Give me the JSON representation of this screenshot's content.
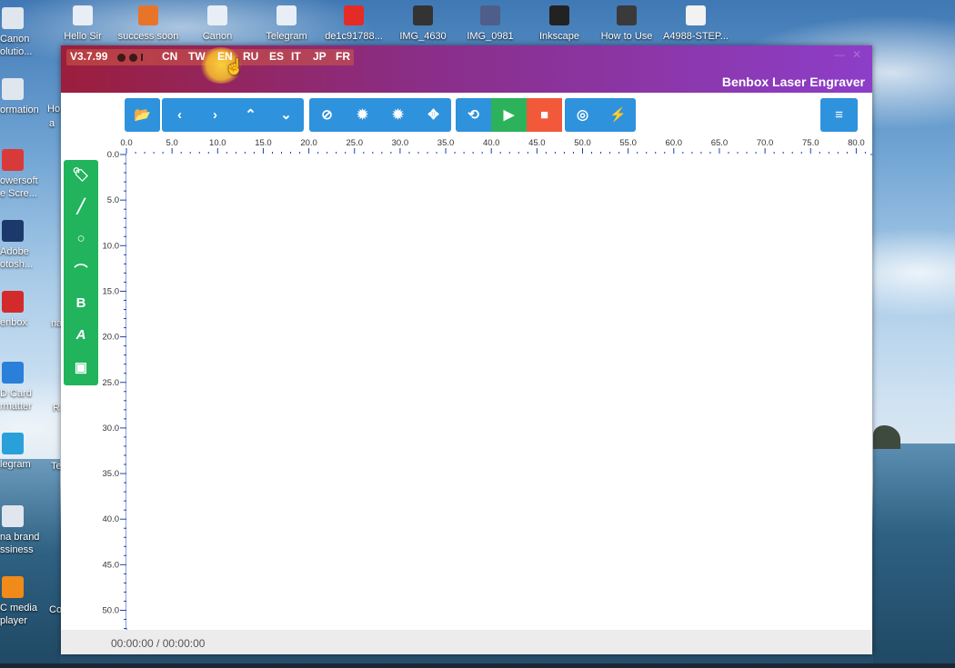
{
  "desktop": {
    "top_icons": [
      {
        "label": "Hello Sir",
        "icon": "document-icon",
        "color": "#e8eef5"
      },
      {
        "label": "success soon",
        "icon": "archive-icon",
        "color": "#e8742a"
      },
      {
        "label": "Canon",
        "icon": "document-icon",
        "color": "#e8eef5"
      },
      {
        "label": "Telegram",
        "icon": "document-icon",
        "color": "#e8eef5"
      },
      {
        "label": "de1c91788...",
        "icon": "youtube-icon",
        "color": "#e52b26"
      },
      {
        "label": "IMG_4630",
        "icon": "image-icon",
        "color": "#333333"
      },
      {
        "label": "IMG_0981",
        "icon": "image-icon",
        "color": "#4e5d8a"
      },
      {
        "label": "Inkscape",
        "icon": "inkscape-icon",
        "color": "#222222"
      },
      {
        "label": "How to Use",
        "icon": "image-icon",
        "color": "#3a3a3a"
      },
      {
        "label": "A4988-STEP...",
        "icon": "document-icon",
        "color": "#f2f2f2"
      }
    ],
    "left_icons": [
      {
        "label": "Canon",
        "label2": "olutio...",
        "icon": "document-icon",
        "color": "#dfe6ee"
      },
      {
        "label": "ormation",
        "label2": "",
        "icon": "document-icon",
        "color": "#dfe6ee"
      },
      {
        "label": "owersoft",
        "label2": "e Scre...",
        "icon": "record-icon",
        "color": "#d83a3a"
      },
      {
        "label": "Adobe",
        "label2": "otosh...",
        "icon": "photoshop-icon",
        "color": "#1b3a6b"
      },
      {
        "label": "enbox",
        "label2": "",
        "icon": "benbox-icon",
        "color": "#d32b2b"
      },
      {
        "label": "D Card",
        "label2": "rmatter",
        "icon": "sdcard-icon",
        "color": "#2a7fd8"
      },
      {
        "label": "legram",
        "label2": "",
        "icon": "telegram-icon",
        "color": "#2aa0da"
      },
      {
        "label": "na brand",
        "label2": "ssiness",
        "icon": "document-icon",
        "color": "#dfe6ee"
      },
      {
        "label": "C media",
        "label2": "player",
        "icon": "vlc-icon",
        "color": "#f08a18"
      }
    ],
    "left_fragments": [
      "Ho",
      "a",
      "na",
      "R",
      "Te",
      "Co"
    ]
  },
  "app": {
    "version": "V3.7.99",
    "languages": [
      "CN",
      "TW",
      "EN",
      "RU",
      "ES",
      "IT",
      "JP",
      "FR"
    ],
    "selected_language": "EN",
    "title": "Benbox Laser Engraver",
    "toolbar": {
      "file_group": [
        {
          "name": "open-folder",
          "icon": "folder-open-icon",
          "glyph": "📂"
        }
      ],
      "move_group": [
        {
          "name": "move-left",
          "icon": "chevron-left-icon",
          "glyph": "‹"
        },
        {
          "name": "move-right",
          "icon": "chevron-right-icon",
          "glyph": "›"
        },
        {
          "name": "move-up",
          "icon": "chevron-up-icon",
          "glyph": "⌃"
        },
        {
          "name": "move-down",
          "icon": "chevron-down-icon",
          "glyph": "⌄"
        }
      ],
      "laser_group": [
        {
          "name": "disable",
          "icon": "ban-icon",
          "glyph": "⊘"
        },
        {
          "name": "laser-low",
          "icon": "sun-small-icon",
          "glyph": "✹"
        },
        {
          "name": "laser-high",
          "icon": "sun-icon",
          "glyph": "✹"
        },
        {
          "name": "center",
          "icon": "crosshair-icon",
          "glyph": "✥"
        }
      ],
      "run_group": [
        {
          "name": "repeat",
          "icon": "repeat-icon",
          "glyph": "⟲",
          "style": "blue"
        },
        {
          "name": "start",
          "icon": "play-icon",
          "glyph": "▶",
          "style": "green"
        },
        {
          "name": "stop",
          "icon": "stop-icon",
          "glyph": "■",
          "style": "red"
        }
      ],
      "misc_group": [
        {
          "name": "gcode",
          "icon": "at-icon",
          "glyph": "◎"
        },
        {
          "name": "flash",
          "icon": "bolt-icon",
          "glyph": "⚡"
        }
      ],
      "menu": {
        "name": "menu",
        "icon": "hamburger-menu-icon",
        "glyph": "≡"
      }
    },
    "sidebar_tools": [
      {
        "name": "tag",
        "icon": "tag-icon",
        "glyph": "🏷"
      },
      {
        "name": "line",
        "icon": "line-icon",
        "glyph": "╱"
      },
      {
        "name": "circle",
        "icon": "circle-icon",
        "glyph": "○"
      },
      {
        "name": "arc",
        "icon": "arc-icon",
        "glyph": "⌒"
      },
      {
        "name": "bold-text",
        "icon": "bold-icon",
        "glyph": "B"
      },
      {
        "name": "text",
        "icon": "text-icon",
        "glyph": "A"
      },
      {
        "name": "image",
        "icon": "image-icon",
        "glyph": "▣"
      }
    ],
    "ruler_x_labels": [
      "0.0",
      "5.0",
      "10.0",
      "15.0",
      "20.0",
      "25.0",
      "30.0",
      "35.0",
      "40.0",
      "45.0",
      "50.0",
      "55.0",
      "60.0",
      "65.0",
      "70.0",
      "75.0",
      "80.0"
    ],
    "ruler_y_labels": [
      "0.0",
      "5.0",
      "10.0",
      "15.0",
      "20.0",
      "25.0",
      "30.0",
      "35.0",
      "40.0",
      "45.0",
      "50.0"
    ],
    "status_time": "00:00:00 / 00:00:00",
    "colors": {
      "toolbar_blue": "#2f92dc",
      "sidebar_green": "#22b35d",
      "play_green": "#2cb25b",
      "stop_red": "#f2593b",
      "ruler_blue": "#1f3fb0"
    }
  }
}
